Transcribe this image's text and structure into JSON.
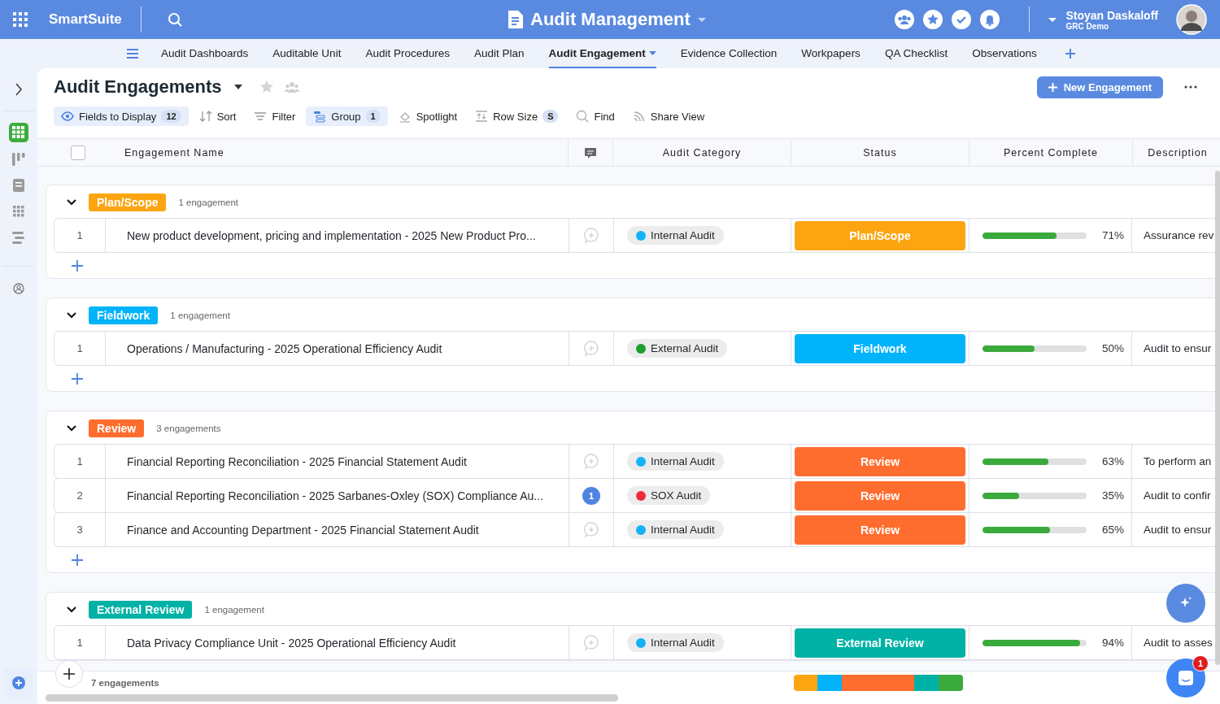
{
  "app": {
    "name": "SmartSuite"
  },
  "solution": {
    "title": "Audit Management"
  },
  "user": {
    "name": "Stoyan Daskaloff",
    "workspace": "GRC Demo"
  },
  "tabs": [
    {
      "label": "Audit Dashboards",
      "selected": false
    },
    {
      "label": "Auditable Unit",
      "selected": false
    },
    {
      "label": "Audit Procedures",
      "selected": false
    },
    {
      "label": "Audit Plan",
      "selected": false
    },
    {
      "label": "Audit Engagement",
      "selected": true
    },
    {
      "label": "Evidence Collection",
      "selected": false
    },
    {
      "label": "Workpapers",
      "selected": false
    },
    {
      "label": "QA Checklist",
      "selected": false
    },
    {
      "label": "Observations",
      "selected": false
    }
  ],
  "sidebar": {
    "views": [
      {
        "kind": "grid",
        "selected": true
      },
      {
        "kind": "kanban",
        "selected": false
      },
      {
        "kind": "form",
        "selected": false
      },
      {
        "kind": "dots",
        "selected": false
      },
      {
        "kind": "timeline",
        "selected": false
      }
    ]
  },
  "view": {
    "title": "Audit Engagements",
    "new_button": "New Engagement"
  },
  "toolbar": [
    {
      "kind": "fields",
      "label": "Fields to Display",
      "badge": "12",
      "active": true
    },
    {
      "kind": "sort",
      "label": "Sort",
      "active": false
    },
    {
      "kind": "filter",
      "label": "Filter",
      "active": false
    },
    {
      "kind": "group",
      "label": "Group",
      "badge": "1",
      "active": true
    },
    {
      "kind": "spotlight",
      "label": "Spotlight",
      "active": false
    },
    {
      "kind": "rowsize",
      "label": "Row Size",
      "badge": "S",
      "active": false
    },
    {
      "kind": "find",
      "label": "Find",
      "active": false
    },
    {
      "kind": "share",
      "label": "Share View",
      "active": false
    }
  ],
  "table": {
    "select_all": {
      "checked": false
    },
    "columns": [
      "Engagement Name",
      "Audit Category",
      "Status",
      "Percent Complete",
      "Description"
    ],
    "groups": [
      {
        "label": "Plan/Scope",
        "color": "#fca511",
        "count": "1 engagement",
        "expanded": true,
        "rows": [
          {
            "number": "1",
            "name": "New product development, pricing and implementation - 2025 New Product Pro...",
            "category": {
              "label": "Internal Audit",
              "color": "#14b2f8"
            },
            "status": {
              "label": "Plan/Scope",
              "color": "#fca511"
            },
            "percent": {
              "level": 0.71,
              "reading": "71%"
            },
            "description": "Assurance rev"
          }
        ]
      },
      {
        "label": "Fieldwork",
        "color": "#00b3fa",
        "count": "1 engagement",
        "expanded": true,
        "rows": [
          {
            "number": "1",
            "name": "Operations / Manufacturing - 2025 Operational Efficiency Audit",
            "category": {
              "label": "External Audit",
              "color": "#1f9e2d"
            },
            "status": {
              "label": "Fieldwork",
              "color": "#00b3fa"
            },
            "percent": {
              "level": 0.5,
              "reading": "50%"
            },
            "description": "Audit to ensur"
          }
        ]
      },
      {
        "label": "Review",
        "color": "#ff6d2e",
        "count": "3 engagements",
        "expanded": true,
        "rows": [
          {
            "number": "1",
            "name": "Financial Reporting Reconciliation - 2025 Financial Statement Audit",
            "category": {
              "label": "Internal Audit",
              "color": "#14b2f8"
            },
            "status": {
              "label": "Review",
              "color": "#ff6d2e"
            },
            "percent": {
              "level": 0.63,
              "reading": "63%"
            },
            "description": "To perform an"
          },
          {
            "number": "2",
            "name": "Financial Reporting Reconciliation - 2025 Sarbanes-Oxley (SOX) Compliance Au...",
            "comments": "1",
            "category": {
              "label": "SOX Audit",
              "color": "#ee2c3c"
            },
            "status": {
              "label": "Review",
              "color": "#ff6d2e"
            },
            "percent": {
              "level": 0.35,
              "reading": "35%"
            },
            "description": "Audit to confir"
          },
          {
            "number": "3",
            "name": "Finance and Accounting Department - 2025 Financial Statement Audit",
            "category": {
              "label": "Internal Audit",
              "color": "#14b2f8"
            },
            "status": {
              "label": "Review",
              "color": "#ff6d2e"
            },
            "percent": {
              "level": 0.65,
              "reading": "65%"
            },
            "description": "Audit to ensur"
          }
        ]
      },
      {
        "label": "External Review",
        "color": "#00b2a5",
        "count": "1 engagement",
        "expanded": true,
        "rows": [
          {
            "number": "1",
            "name": "Data Privacy Compliance Unit - 2025 Operational Efficiency Audit",
            "category": {
              "label": "Internal Audit",
              "color": "#14b2f8"
            },
            "status": {
              "label": "External Review",
              "color": "#00b2a5"
            },
            "percent": {
              "level": 0.94,
              "reading": "94%"
            },
            "description": "Audit to asses"
          }
        ]
      }
    ]
  },
  "footer": {
    "total": "7 engagements",
    "summary": [
      {
        "color": "#fca511"
      },
      {
        "color": "#00b3fa"
      },
      {
        "color": "#ff6d2e"
      },
      {
        "color": "#00b2a5"
      },
      {
        "color": "#3aaa3c"
      }
    ]
  },
  "chat": {
    "badge": "1"
  }
}
